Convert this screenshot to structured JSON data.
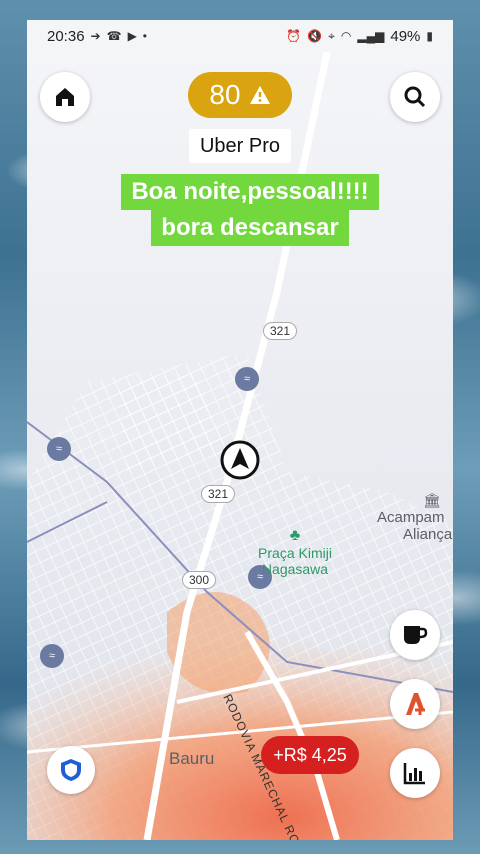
{
  "status_bar": {
    "time": "20:36",
    "battery": "49%",
    "left_icons": [
      "forward-icon",
      "missed-call-icon",
      "youtube-icon",
      "dot-icon"
    ],
    "right_icons": [
      "alarm-icon",
      "mute-icon",
      "location-icon",
      "wifi-icon",
      "signal-icon",
      "battery-icon"
    ]
  },
  "header": {
    "home_icon": "home-icon",
    "search_icon": "search-icon",
    "score": "80",
    "score_icon": "warning-icon",
    "tier": "Uber Pro"
  },
  "message": {
    "line1": "Boa noite,pessoal!!!!",
    "line2": "bora descansar"
  },
  "map": {
    "route_shields": [
      "321",
      "321",
      "300"
    ],
    "poi_name_line1": "Praça Kimiji",
    "poi_name_line2": "Nagasawa",
    "place_label_line1": "Acampam",
    "place_label_line2": "Aliança",
    "city": "Bauru",
    "road": "RODOVIA MARECHAL RONDON",
    "heat_color": "#f07050"
  },
  "buttons": {
    "shield_icon": "shield-icon",
    "coffee_icon": "coffee-icon",
    "boost_icon": "boost-icon",
    "chart_icon": "bar-chart-icon",
    "earnings": "+R$ 4,25"
  }
}
